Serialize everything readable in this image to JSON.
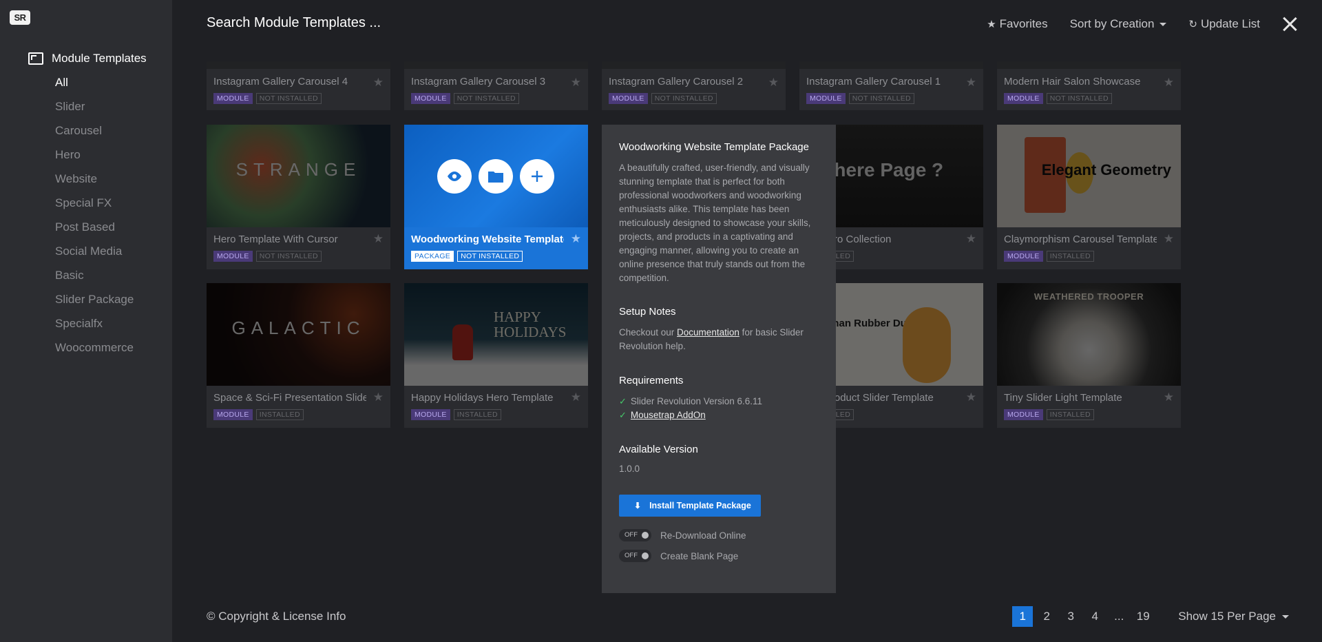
{
  "app": {
    "logo": "SR"
  },
  "sidebar": {
    "title": "Module Templates",
    "items": [
      {
        "label": "All",
        "active": true
      },
      {
        "label": "Slider"
      },
      {
        "label": "Carousel"
      },
      {
        "label": "Hero"
      },
      {
        "label": "Website"
      },
      {
        "label": "Special FX"
      },
      {
        "label": "Post Based"
      },
      {
        "label": "Social Media"
      },
      {
        "label": "Basic"
      },
      {
        "label": "Slider Package"
      },
      {
        "label": "Specialfx"
      },
      {
        "label": "Woocommerce"
      }
    ]
  },
  "header": {
    "search_placeholder": "Search Module Templates ...",
    "favorites": "Favorites",
    "sort": "Sort by Creation",
    "update": "Update List"
  },
  "cards": {
    "r1c1": {
      "title": "Instagram Gallery Carousel 4",
      "type": "MODULE",
      "status": "NOT INSTALLED"
    },
    "r1c2": {
      "title": "Instagram Gallery Carousel 3",
      "type": "MODULE",
      "status": "NOT INSTALLED"
    },
    "r1c3": {
      "title": "Instagram Gallery Carousel 2",
      "type": "MODULE",
      "status": "NOT INSTALLED"
    },
    "r1c4": {
      "title": "Instagram Gallery Carousel 1",
      "type": "MODULE",
      "status": "NOT INSTALLED"
    },
    "r1c5": {
      "title": "Modern Hair Salon Showcase",
      "type": "MODULE",
      "status": "NOT INSTALLED"
    },
    "r2c1": {
      "title": "Hero Template With Cursor",
      "type": "MODULE",
      "status": "NOT INSTALLED",
      "art": "STRANGE"
    },
    "r2c2": {
      "title": "Woodworking Website Template",
      "type": "PACKAGE",
      "status": "NOT INSTALLED"
    },
    "r2c4": {
      "title": "ge Hero Collection",
      "status": "INSTALLED",
      "art": "Where Page ?"
    },
    "r2c5": {
      "title": "Claymorphism Carousel Template",
      "type": "MODULE",
      "status": "INSTALLED",
      "art": "Elegant Geometry"
    },
    "r3c1": {
      "title": "Space & Sci-Fi Presentation Slider",
      "type": "MODULE",
      "status": "INSTALLED",
      "art": "GALACTIC"
    },
    "r3c2": {
      "title": "Happy Holidays Hero Template",
      "type": "MODULE",
      "status": "INSTALLED",
      "art": "HAPPY HOLIDAYS"
    },
    "r3c4": {
      "title": "ore Product Slider Template",
      "status": "INSTALLED",
      "art": "Batman Rubber Ducky"
    },
    "r3c5": {
      "title": "Tiny Slider Light Template",
      "type": "MODULE",
      "status": "INSTALLED",
      "art": "WEATHERED TROOPER"
    }
  },
  "details": {
    "title": "Woodworking Website Template Package",
    "description": "A beautifully crafted, user-friendly, and visually stunning template that is perfect for both professional woodworkers and woodworking enthusiasts alike. This template has been meticulously designed to showcase your skills, projects, and products in a captivating and engaging manner, allowing you to create an online presence that truly stands out from the competition.",
    "setup_heading": "Setup Notes",
    "setup_pre": "Checkout our ",
    "setup_link": "Documentation",
    "setup_post": " for basic Slider Revolution help.",
    "req_heading": "Requirements",
    "req1": "Slider Revolution Version 6.6.11",
    "req2": "Mousetrap AddOn",
    "version_heading": "Available Version",
    "version": "1.0.0",
    "install": "Install Template Package",
    "toggle_off": "OFF",
    "toggle1": "Re-Download Online",
    "toggle2": "Create Blank Page"
  },
  "footer": {
    "copyright": "© Copyright & License Info",
    "pages": [
      "1",
      "2",
      "3",
      "4",
      "...",
      "19"
    ],
    "active_page": "1",
    "per_page": "Show 15 Per Page"
  },
  "colors": {
    "accent": "#1a74d8",
    "module_badge": "#4a3a78",
    "check": "#46c96a"
  }
}
